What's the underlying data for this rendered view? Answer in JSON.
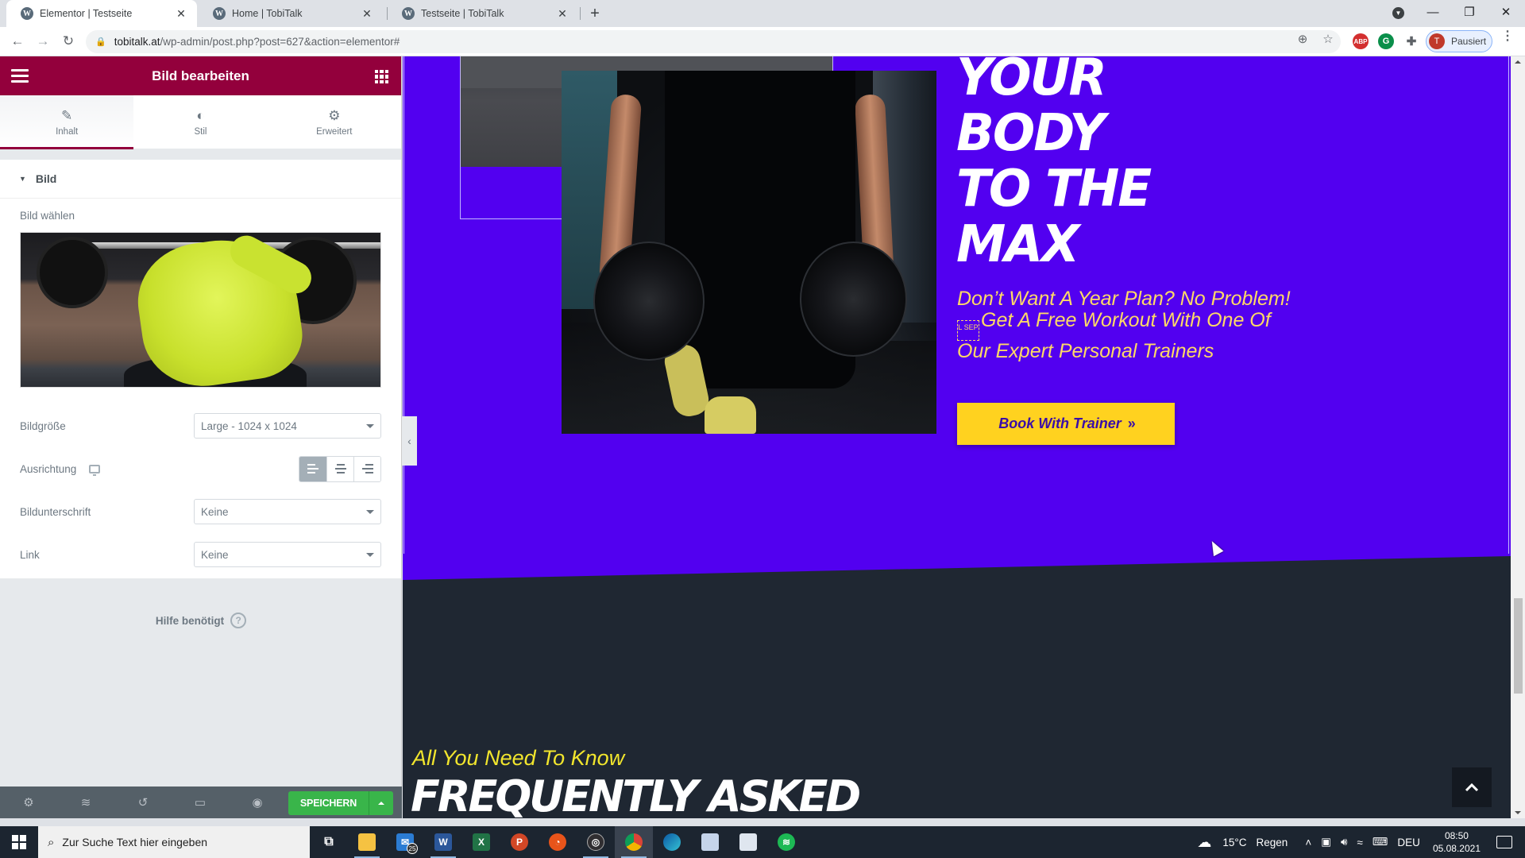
{
  "browser": {
    "tabs": [
      {
        "title": "Elementor | Testseite",
        "active": true,
        "icon": "wordpress-icon"
      },
      {
        "title": "Home | TobiTalk",
        "active": false,
        "icon": "wordpress-icon"
      },
      {
        "title": "Testseite | TobiTalk",
        "active": false,
        "icon": "wordpress-icon"
      }
    ],
    "new_tab": "+",
    "url_host": "tobitalk.at",
    "url_path": "/wp-admin/post.php?post=627&action=elementor#",
    "profile_status": "Pausiert",
    "profile_initial": "T",
    "extensions": [
      "ABP",
      "grammarly",
      "extensions-puzzle"
    ]
  },
  "panel": {
    "title": "Bild bearbeiten",
    "tabs": [
      {
        "label": "Inhalt",
        "icon": "pencil-icon",
        "active": true
      },
      {
        "label": "Stil",
        "icon": "contrast-icon",
        "active": false
      },
      {
        "label": "Erweitert",
        "icon": "gear-icon",
        "active": false
      }
    ],
    "section_title": "Bild",
    "choose_image_label": "Bild wählen",
    "fields": {
      "size": {
        "label": "Bildgröße",
        "value": "Large - 1024 x 1024"
      },
      "alignment": {
        "label": "Ausrichtung",
        "options": [
          "left",
          "center",
          "right"
        ],
        "selected": "left"
      },
      "caption": {
        "label": "Bildunterschrift",
        "value": "Keine"
      },
      "link": {
        "label": "Link",
        "value": "Keine"
      }
    },
    "help_label": "Hilfe benötigt",
    "footer": {
      "save_label": "SPEICHERN"
    }
  },
  "preview": {
    "headline_lines": [
      "YOUR",
      "BODY",
      "TO THE",
      "MAX"
    ],
    "subtext_line1": "Don’t Want A Year Plan? No Problem!",
    "subtext_sep": "L SEP",
    "subtext_line2": "Get A Free Workout With One Of",
    "subtext_line3": "Our Expert Personal Trainers",
    "cta_label": "Book With Trainer",
    "cta_icon": "»",
    "faq_kicker": "All You Need To Know",
    "faq_title": "FREQUENTLY ASKED",
    "colors": {
      "hero_bg": "#5200f0",
      "cta_bg": "#ffd21f",
      "accent_yellow": "#ffd966",
      "dark_bg": "#1f2732",
      "elementor_brand": "#93003c",
      "save_green": "#39b54a"
    }
  },
  "taskbar": {
    "search_placeholder": "Zur Suche Text hier eingeben",
    "mail_badge": "25",
    "weather": "15°C",
    "weather_desc": "Regen",
    "language": "DEU",
    "time": "08:50",
    "date": "05.08.2021"
  }
}
